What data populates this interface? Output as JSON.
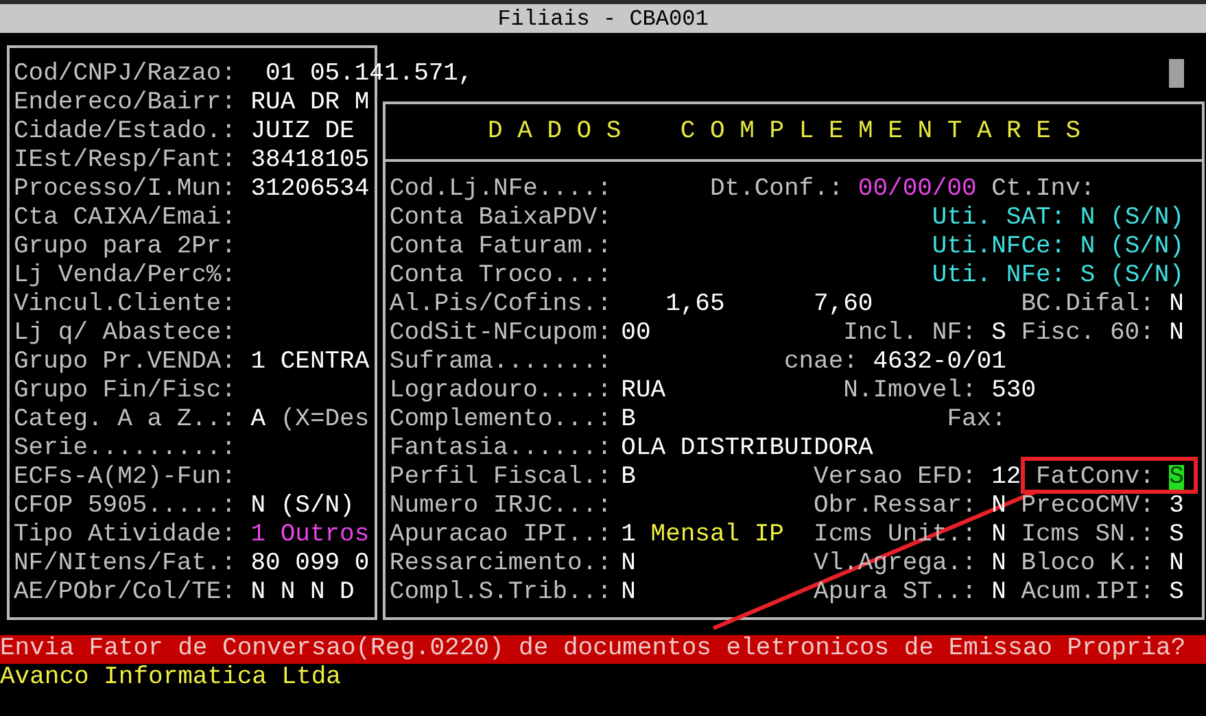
{
  "window": {
    "title": "Filiais - CBA001"
  },
  "left_rows": [
    {
      "label": "Cod/CNPJ/Razao:",
      "values": [
        {
          "text": "01 05.141.571,",
          "color": "#ffffff"
        }
      ]
    },
    {
      "label": "Endereco/Bairr:",
      "values": [
        {
          "text": "RUA DR M",
          "color": "#ffffff"
        }
      ]
    },
    {
      "label": "Cidade/Estado.:",
      "values": [
        {
          "text": "JUIZ DE",
          "color": "#ffffff"
        }
      ]
    },
    {
      "label": "IEst/Resp/Fant:",
      "values": [
        {
          "text": "38418105",
          "color": "#ffffff"
        }
      ]
    },
    {
      "label": "Processo/I.Mun:",
      "values": [
        {
          "text": "31206534",
          "color": "#ffffff"
        }
      ]
    },
    {
      "label": "Cta CAIXA/Emai:",
      "values": []
    },
    {
      "label": "Grupo para 2Pr:",
      "values": []
    },
    {
      "label": "Lj Venda/Perc%:",
      "values": []
    },
    {
      "label": "Vincul.Cliente:",
      "values": []
    },
    {
      "label": "Lj q/ Abastece:",
      "values": []
    },
    {
      "label": "Grupo Pr.VENDA:",
      "values": [
        {
          "text": "1 CENTRA",
          "color": "#ffffff"
        }
      ]
    },
    {
      "label": "Grupo Fin/Fisc:",
      "values": []
    },
    {
      "label": "Categ. A a Z..:",
      "values": [
        {
          "text": "A",
          "color": "#ffffff"
        },
        {
          "text": "(X=Des",
          "color": "#c0c0c0"
        }
      ]
    },
    {
      "label": "Serie.........:",
      "values": []
    },
    {
      "label": "ECFs-A(M2)-Fun:",
      "values": []
    },
    {
      "label": "CFOP 5905.....:",
      "values": [
        {
          "text": "N (S/N)",
          "color": "#ffffff"
        }
      ]
    },
    {
      "label": "Tipo Atividade:",
      "values": [
        {
          "text": "1 Outros",
          "color": "#e844e8"
        }
      ]
    },
    {
      "label": "NF/NItens/Fat.:",
      "values": [
        {
          "text": "80 099 0",
          "color": "#ffffff"
        }
      ]
    },
    {
      "label": "AE/PObr/Col/TE:",
      "values": [
        {
          "text": "N N N D",
          "color": "#ffffff"
        }
      ]
    }
  ],
  "panel": {
    "title": "D A D O S    C O M P L E M E N T A R E S",
    "rows": [
      {
        "label": "Cod.Lj.NFe....:",
        "fields": [
          {
            "text": "Dt.Conf.:",
            "kind": "label",
            "focused": false
          },
          {
            "text": "00/00/00",
            "kind": "value",
            "color": "#e844e8",
            "focused": false
          },
          {
            "text": "Ct.Inv:",
            "kind": "label",
            "focused": false
          }
        ]
      },
      {
        "label": "Conta BaixaPDV:",
        "fields": [
          {
            "text": "Uti. SAT: N (S/N)",
            "kind": "label",
            "color": "#40e0e0",
            "focused": false
          }
        ]
      },
      {
        "label": "Conta Faturam.:",
        "fields": [
          {
            "text": "Uti.NFCe: N (S/N)",
            "kind": "label",
            "color": "#40e0e0",
            "focused": false
          }
        ]
      },
      {
        "label": "Conta Troco...:",
        "fields": [
          {
            "text": "Uti. NFe: S (S/N)",
            "kind": "label",
            "color": "#40e0e0",
            "focused": false
          }
        ]
      },
      {
        "label": "Al.Pis/Cofins.:",
        "fields": [
          {
            "text": "1,65",
            "kind": "value",
            "focused": false
          },
          {
            "text": "7,60",
            "kind": "value",
            "focused": false
          },
          {
            "text": "BC.Difal:",
            "kind": "label",
            "focused": false
          },
          {
            "text": "N",
            "kind": "value",
            "focused": false
          }
        ]
      },
      {
        "label": "CodSit-NFcupom:",
        "fields": [
          {
            "text": "00",
            "kind": "value",
            "focused": false
          },
          {
            "text": "Incl. NF:",
            "kind": "label",
            "focused": false
          },
          {
            "text": "S",
            "kind": "value",
            "focused": false
          },
          {
            "text": "Fisc. 60:",
            "kind": "label",
            "focused": false
          },
          {
            "text": "N",
            "kind": "value",
            "focused": false
          }
        ]
      },
      {
        "label": "Suframa.......:",
        "fields": [
          {
            "text": "cnae:",
            "kind": "label",
            "focused": false
          },
          {
            "text": "4632-0/01",
            "kind": "value",
            "focused": false
          }
        ]
      },
      {
        "label": "Logradouro....:",
        "fields": [
          {
            "text": "RUA",
            "kind": "value",
            "focused": false
          },
          {
            "text": "N.Imovel:",
            "kind": "label",
            "focused": false
          },
          {
            "text": "530",
            "kind": "value",
            "focused": false
          }
        ]
      },
      {
        "label": "Complemento...:",
        "fields": [
          {
            "text": "B",
            "kind": "value",
            "focused": false
          },
          {
            "text": "Fax:",
            "kind": "label",
            "focused": false
          }
        ]
      },
      {
        "label": "Fantasia......:",
        "fields": [
          {
            "text": "OLA DISTRIBUIDORA",
            "kind": "value",
            "focused": false
          }
        ]
      },
      {
        "label": "Perfil Fiscal.:",
        "fields": [
          {
            "text": "B",
            "kind": "value",
            "focused": false
          },
          {
            "text": "Versao EFD:",
            "kind": "label",
            "focused": false
          },
          {
            "text": "12",
            "kind": "value",
            "focused": false
          },
          {
            "text": "FatConv:",
            "kind": "label",
            "focused": false
          },
          {
            "text": "S",
            "kind": "value",
            "focused": true
          }
        ]
      },
      {
        "label": "Numero IRJC...:",
        "fields": [
          {
            "text": "Obr.Ressar:",
            "kind": "label",
            "focused": false
          },
          {
            "text": "N",
            "kind": "value",
            "focused": false
          },
          {
            "text": "PrecoCMV:",
            "kind": "label",
            "focused": false
          },
          {
            "text": "3",
            "kind": "value",
            "focused": false
          }
        ]
      },
      {
        "label": "Apuracao IPI..:",
        "fields": [
          {
            "text": "1",
            "kind": "value",
            "focused": false
          },
          {
            "text": "Mensal IP",
            "kind": "value",
            "color": "#f0f040",
            "focused": false
          },
          {
            "text": "Icms Unit.:",
            "kind": "label",
            "focused": false
          },
          {
            "text": "N",
            "kind": "value",
            "focused": false
          },
          {
            "text": "Icms SN.:",
            "kind": "label",
            "focused": false
          },
          {
            "text": "S",
            "kind": "value",
            "focused": false
          }
        ]
      },
      {
        "label": "Ressarcimento.:",
        "fields": [
          {
            "text": "N",
            "kind": "value",
            "focused": false
          },
          {
            "text": "Vl.Agrega.:",
            "kind": "label",
            "focused": false
          },
          {
            "text": "N",
            "kind": "value",
            "focused": false
          },
          {
            "text": "Bloco K.:",
            "kind": "label",
            "focused": false
          },
          {
            "text": "N",
            "kind": "value",
            "focused": false
          }
        ]
      },
      {
        "label": "Compl.S.Trib..:",
        "fields": [
          {
            "text": "N",
            "kind": "value",
            "focused": false
          },
          {
            "text": "Apura ST..:",
            "kind": "label",
            "focused": false
          },
          {
            "text": "N",
            "kind": "value",
            "focused": false
          },
          {
            "text": "Acum.IPI:",
            "kind": "label",
            "focused": false
          },
          {
            "text": "S",
            "kind": "value",
            "focused": false
          }
        ]
      }
    ]
  },
  "status_message": "Envia Fator de Conversao(Reg.0220) de documentos eletronicos de Emissao Propria?",
  "footer": "Avanco Informatica Ltda"
}
